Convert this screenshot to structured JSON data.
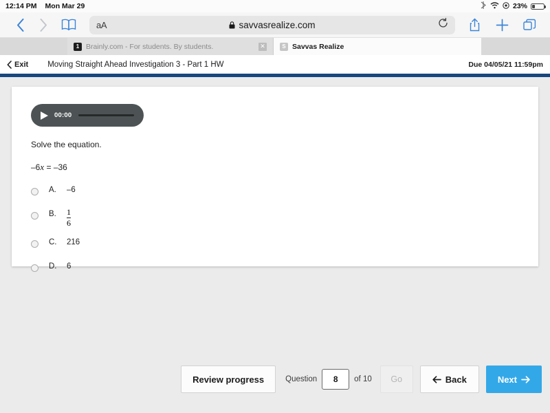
{
  "status_bar": {
    "time": "12:14 PM",
    "date": "Mon Mar 29",
    "battery_percent": "23%",
    "icons": [
      "bluetooth-icon",
      "wifi-icon",
      "rotation-lock-icon",
      "battery-icon"
    ]
  },
  "browser": {
    "back_icon": "chevron-left-icon",
    "forward_icon": "chevron-right-icon",
    "bookmarks_icon": "book-icon",
    "text_size_label": "aA",
    "lock_icon": "lock-icon",
    "url": "savvasrealize.com",
    "reload_icon": "reload-icon",
    "share_icon": "share-icon",
    "new_tab_icon": "plus-icon",
    "tabs_icon": "tabs-icon",
    "accent_color": "#3a84d8",
    "tabs": [
      {
        "title": "Brainly.com - For students. By students.",
        "favicon": "brainly-favicon",
        "active": false,
        "close_icon": "close-icon"
      },
      {
        "title": "Savvas Realize",
        "favicon": "savvas-favicon",
        "active": true
      }
    ]
  },
  "app_header": {
    "exit_label": "Exit",
    "exit_icon": "chevron-left-icon",
    "assignment_title": "Moving Straight Ahead Investigation 3 - Part 1 HW",
    "due_label": "Due 04/05/21 11:59pm",
    "rule_color": "#17477e"
  },
  "question": {
    "audio": {
      "play_icon": "play-icon",
      "time": "00:00"
    },
    "prompt": "Solve the equation.",
    "equation_prefix": "–6",
    "equation_variable": "x",
    "equation_suffix": " = –36",
    "options": [
      {
        "letter": "A.",
        "value": "–6",
        "selected": false,
        "type": "text"
      },
      {
        "letter": "B.",
        "numerator": "1",
        "denominator": "6",
        "selected": false,
        "type": "fraction"
      },
      {
        "letter": "C.",
        "value": "216",
        "selected": false,
        "type": "text"
      },
      {
        "letter": "D.",
        "value": "6",
        "selected": false,
        "type": "text"
      }
    ]
  },
  "bottom_bar": {
    "review_label": "Review progress",
    "question_label": "Question",
    "question_number": "8",
    "of_label": "of 10",
    "go_label": "Go",
    "go_disabled": true,
    "back_label": "Back",
    "back_icon": "arrow-left-icon",
    "next_label": "Next",
    "next_icon": "arrow-right-icon",
    "next_color": "#33a8e8"
  }
}
